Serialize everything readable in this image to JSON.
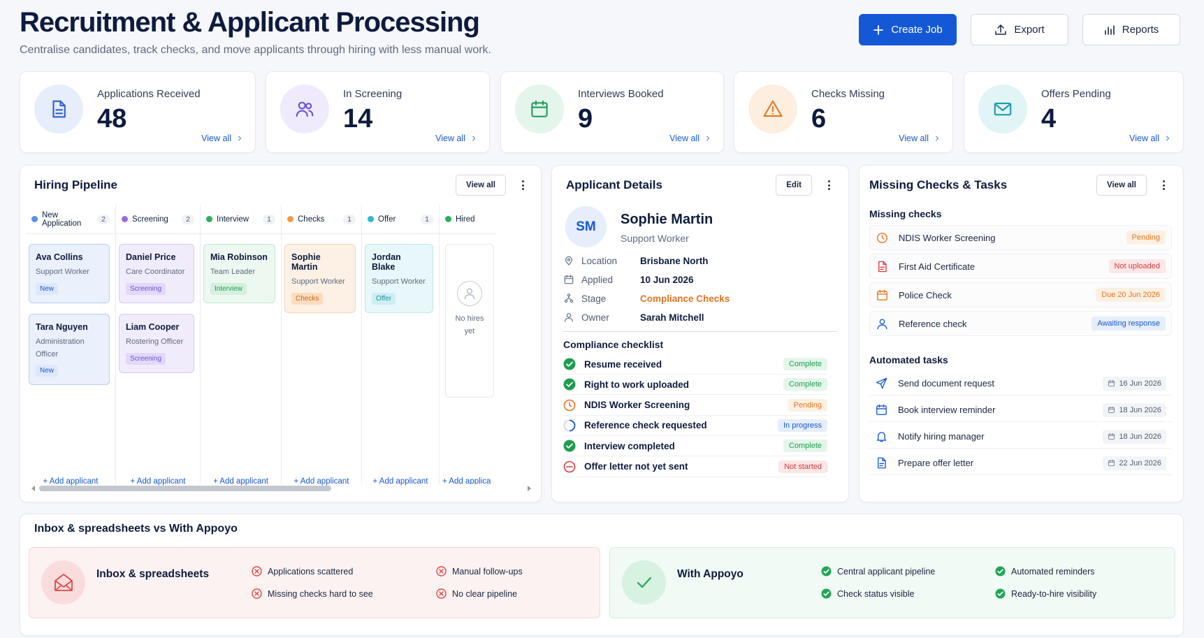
{
  "header": {
    "title": "Recruitment & Applicant Processing",
    "subtitle": "Centralise candidates, track checks, and move applicants through hiring with less manual work.",
    "buttons": {
      "create": "Create Job",
      "export": "Export",
      "reports": "Reports"
    }
  },
  "stats": [
    {
      "label": "Applications Received",
      "value": "48",
      "link": "View all",
      "icon": "document-icon",
      "color": "#2f5fd0",
      "bg": "#e6edfb"
    },
    {
      "label": "In Screening",
      "value": "14",
      "link": "View all",
      "icon": "users-icon",
      "color": "#6d4fd6",
      "bg": "#efeafc"
    },
    {
      "label": "Interviews Booked",
      "value": "9",
      "link": "View all",
      "icon": "calendar-icon",
      "color": "#1f9d5a",
      "bg": "#e4f6ec"
    },
    {
      "label": "Checks Missing",
      "value": "6",
      "link": "View all",
      "icon": "warning-icon",
      "color": "#e07a1c",
      "bg": "#fdeee0"
    },
    {
      "label": "Offers Pending",
      "value": "4",
      "link": "View all",
      "icon": "mail-icon",
      "color": "#1a9db0",
      "bg": "#e1f4f6"
    }
  ],
  "pipeline": {
    "title": "Hiring Pipeline",
    "view_all": "View all",
    "add_label": "+ Add applicant",
    "add_label_cut": "+ Add applica",
    "columns": [
      {
        "name": "New Application",
        "count": "2",
        "color": "#5b8ee8",
        "cards": [
          {
            "name": "Ava Collins",
            "role": "Support Worker",
            "badge": "New"
          },
          {
            "name": "Tara Nguyen",
            "role": "Administration Officer",
            "badge": "New"
          }
        ]
      },
      {
        "name": "Screening",
        "count": "2",
        "color": "#9b6ae0",
        "cards": [
          {
            "name": "Daniel Price",
            "role": "Care Coordinator",
            "badge": "Screening"
          },
          {
            "name": "Liam Cooper",
            "role": "Rostering Officer",
            "badge": "Screening"
          }
        ]
      },
      {
        "name": "Interview",
        "count": "1",
        "color": "#2bb15e",
        "cards": [
          {
            "name": "Mia Robinson",
            "role": "Team Leader",
            "badge": "Interview"
          }
        ]
      },
      {
        "name": "Checks",
        "count": "1",
        "color": "#f29a4a",
        "cards": [
          {
            "name": "Sophie Martin",
            "role": "Support Worker",
            "badge": "Checks"
          }
        ]
      },
      {
        "name": "Offer",
        "count": "1",
        "color": "#33b8cf",
        "cards": [
          {
            "name": "Jordan Blake",
            "role": "Support Worker",
            "badge": "Offer"
          }
        ]
      },
      {
        "name": "Hired",
        "count": "",
        "color": "#2bb15e",
        "empty_text": "No hires yet",
        "cards": []
      }
    ]
  },
  "applicant": {
    "title": "Applicant Details",
    "edit": "Edit",
    "initials": "SM",
    "name": "Sophie Martin",
    "role": "Support Worker",
    "info": [
      {
        "key": "Location",
        "value": "Brisbane North",
        "icon": "location-icon"
      },
      {
        "key": "Applied",
        "value": "10 Jun 2026",
        "icon": "calendar-icon"
      },
      {
        "key": "Stage",
        "value": "Compliance Checks",
        "icon": "stage-icon",
        "accent": "#e8731a"
      },
      {
        "key": "Owner",
        "value": "Sarah Mitchell",
        "icon": "user-icon"
      }
    ],
    "checklist_title": "Compliance checklist",
    "checklist": [
      {
        "label": "Resume received",
        "status": "Complete",
        "kind": "complete"
      },
      {
        "label": "Right to work uploaded",
        "status": "Complete",
        "kind": "complete"
      },
      {
        "label": "NDIS Worker Screening",
        "status": "Pending",
        "kind": "pending"
      },
      {
        "label": "Reference check requested",
        "status": "In progress",
        "kind": "progress"
      },
      {
        "label": "Interview completed",
        "status": "Complete",
        "kind": "complete"
      },
      {
        "label": "Offer letter not yet sent",
        "status": "Not started",
        "kind": "notstarted"
      }
    ]
  },
  "missing": {
    "title": "Missing Checks & Tasks",
    "view_all": "View all",
    "checks_title": "Missing checks",
    "checks": [
      {
        "label": "NDIS Worker Screening",
        "status": "Pending",
        "kind": "pending",
        "icon": "clock-icon"
      },
      {
        "label": "First Aid Certificate",
        "status": "Not uploaded",
        "kind": "notstarted",
        "icon": "file-icon"
      },
      {
        "label": "Police Check",
        "status": "Due 20 Jun 2026",
        "kind": "pending",
        "icon": "calendar-icon"
      },
      {
        "label": "Reference check",
        "status": "Awaiting response",
        "kind": "progress",
        "icon": "user-icon"
      }
    ],
    "tasks_title": "Automated tasks",
    "tasks": [
      {
        "label": "Send document request",
        "date": "16 Jun 2026",
        "icon": "send-icon"
      },
      {
        "label": "Book interview reminder",
        "date": "18 Jun 2026",
        "icon": "calendar-icon"
      },
      {
        "label": "Notify hiring manager",
        "date": "18 Jun 2026",
        "icon": "bell-icon"
      },
      {
        "label": "Prepare offer letter",
        "date": "22 Jun 2026",
        "icon": "file-icon"
      }
    ]
  },
  "compare": {
    "title": "Inbox & spreadsheets vs With Appoyo",
    "left": {
      "title": "Inbox & spreadsheets",
      "items": [
        "Applications scattered",
        "Manual follow-ups",
        "Missing checks hard to see",
        "No clear pipeline"
      ]
    },
    "right": {
      "title": "With Appoyo",
      "items": [
        "Central applicant pipeline",
        "Automated reminders",
        "Check status visible",
        "Ready-to-hire visibility"
      ]
    }
  }
}
